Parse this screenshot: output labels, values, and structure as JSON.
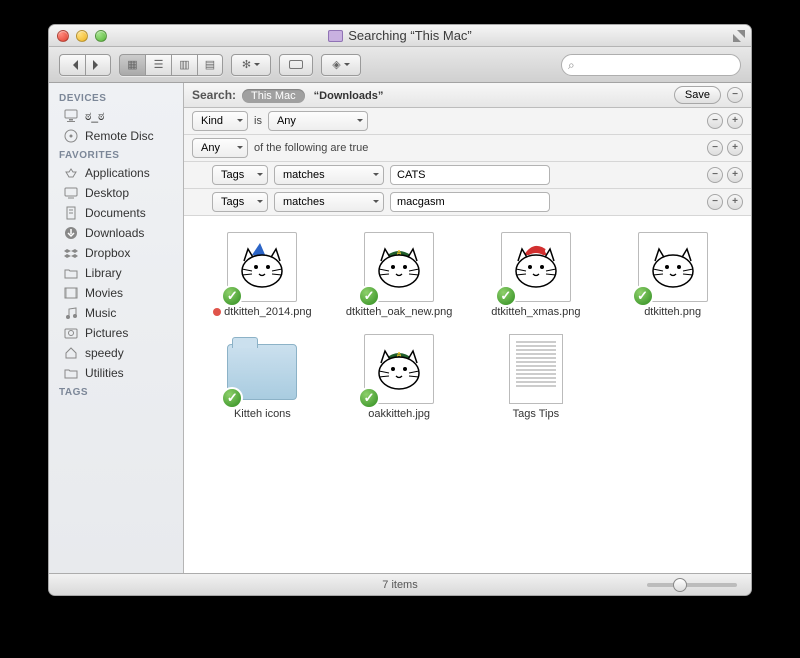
{
  "window": {
    "title": "Searching “This Mac”"
  },
  "sidebar": {
    "sections": [
      {
        "header": "DEVICES",
        "items": [
          {
            "label": "ಠ_ಠ",
            "icon": "imac"
          },
          {
            "label": "Remote Disc",
            "icon": "disc"
          }
        ]
      },
      {
        "header": "FAVORITES",
        "items": [
          {
            "label": "Applications",
            "icon": "apps"
          },
          {
            "label": "Desktop",
            "icon": "desktop"
          },
          {
            "label": "Documents",
            "icon": "docs"
          },
          {
            "label": "Downloads",
            "icon": "down"
          },
          {
            "label": "Dropbox",
            "icon": "dropbox"
          },
          {
            "label": "Library",
            "icon": "folder"
          },
          {
            "label": "Movies",
            "icon": "movies"
          },
          {
            "label": "Music",
            "icon": "music"
          },
          {
            "label": "Pictures",
            "icon": "pictures"
          },
          {
            "label": "speedy",
            "icon": "home"
          },
          {
            "label": "Utilities",
            "icon": "folder"
          }
        ]
      },
      {
        "header": "TAGS",
        "items": []
      }
    ]
  },
  "search": {
    "label": "Search:",
    "scopes": [
      {
        "label": "This Mac",
        "active": true
      },
      {
        "label": "“Downloads”",
        "active": false
      }
    ],
    "save": "Save",
    "rows": [
      {
        "attr": "Kind",
        "op_text": "is",
        "value_drop": "Any",
        "indent": 0,
        "btns": [
          "-",
          "+"
        ]
      },
      {
        "attr": "Any",
        "op_text": "of the following are true",
        "indent": 0,
        "btns": [
          "-",
          "+"
        ]
      },
      {
        "attr": "Tags",
        "op_drop": "matches",
        "input": "CATS",
        "indent": 1,
        "btns": [
          "-",
          "+"
        ]
      },
      {
        "attr": "Tags",
        "op_drop": "matches",
        "input": "macgasm",
        "indent": 1,
        "btns": [
          "-",
          "+"
        ]
      }
    ]
  },
  "results": [
    {
      "name": "dtkitteh_2014.png",
      "kind": "image",
      "hat": "blue",
      "badge": true,
      "reddot": true
    },
    {
      "name": "dtkitteh_oak_new.png",
      "kind": "image",
      "hat": "oak",
      "badge": true
    },
    {
      "name": "dtkitteh_xmas.png",
      "kind": "image",
      "hat": "santa",
      "badge": true
    },
    {
      "name": "dtkitteh.png",
      "kind": "image",
      "hat": "none",
      "badge": true
    },
    {
      "name": "Kitteh icons",
      "kind": "folder",
      "badge": true
    },
    {
      "name": "oakkitteh.jpg",
      "kind": "image",
      "hat": "oak",
      "badge": true
    },
    {
      "name": "Tags Tips",
      "kind": "document"
    }
  ],
  "status": {
    "count_text": "7 items"
  }
}
